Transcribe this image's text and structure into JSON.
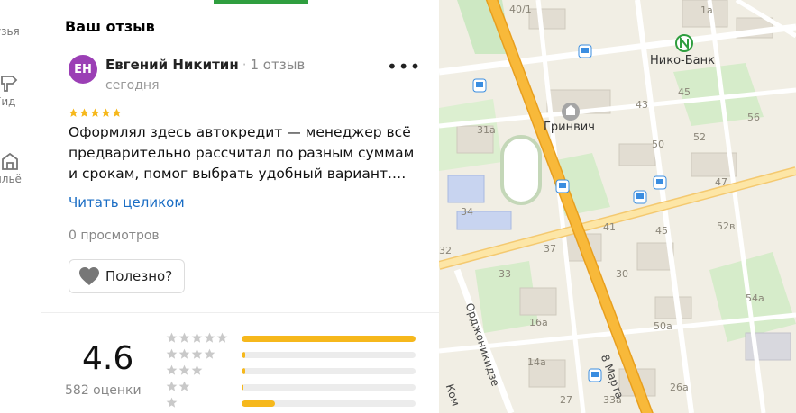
{
  "rail": {
    "items": [
      {
        "label": "узья",
        "icon": "friends-icon"
      },
      {
        "label": "Гид",
        "icon": "guide-icon"
      },
      {
        "label": "ильё",
        "icon": "housing-icon"
      }
    ]
  },
  "panel": {
    "title": "Ваш отзыв",
    "review": {
      "initials": "ЕН",
      "author": "Евгений Никитин",
      "review_count": "1 отзыв",
      "date": "сегодня",
      "rating": 5,
      "text": "Оформлял здесь автокредит — менеджер всё предварительно рассчитал по разным суммам и срокам, помог выбрать удобный вариант.…",
      "read_more": "Читать целиком",
      "views": "0 просмотров",
      "useful_label": "Полезно?"
    },
    "summary": {
      "score": "4.6",
      "votes": "582 оценки",
      "distribution": [
        {
          "stars": 5,
          "fraction": 1.0
        },
        {
          "stars": 4,
          "fraction": 0.02
        },
        {
          "stars": 3,
          "fraction": 0.02
        },
        {
          "stars": 2,
          "fraction": 0.01
        },
        {
          "stars": 1,
          "fraction": 0.19
        }
      ]
    }
  },
  "colors": {
    "avatar": "#9b3fb5",
    "accent_green": "#2f9e3f",
    "link": "#1a6dc4",
    "star": "#f6b81c",
    "star_empty": "#c9c9c9",
    "road_major": "#f8b93a"
  },
  "map": {
    "streets": [
      "8 Марта",
      "Орджоникидзе",
      "Ком"
    ],
    "pois": [
      {
        "name": "Нико-Банк",
        "icon": "metro-icon"
      },
      {
        "name": "Гринвич",
        "icon": "mall-icon"
      }
    ],
    "house_numbers": [
      "40/1",
      "1а",
      "45",
      "43",
      "31а",
      "56",
      "50",
      "52",
      "47",
      "34",
      "41",
      "45",
      "52в",
      "37",
      "32",
      "33",
      "30",
      "54а",
      "16а",
      "50а",
      "14а",
      "27",
      "33а",
      "26а"
    ]
  }
}
